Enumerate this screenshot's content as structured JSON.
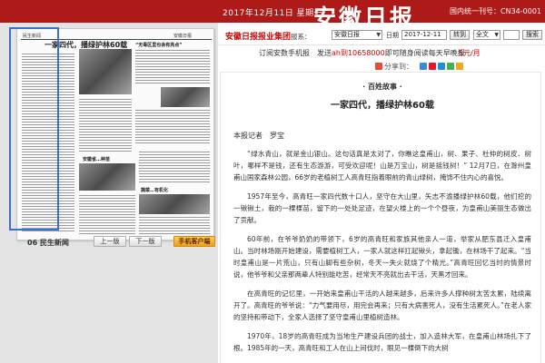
{
  "header": {
    "date_line": "2017年12月11日 星期一",
    "logo": "安徽日报",
    "cn_number": "国内统一刊号：CN34-0001"
  },
  "toolbar": {
    "brand_red": "安徽日报报业集团",
    "brand_dark": "报系：",
    "paper_select": "安徽日报",
    "date_label": "日期",
    "date_value": "2017-12-11",
    "go_button": "转到",
    "search_select": "全文",
    "search_button": "搜索"
  },
  "promo": {
    "text_a": "订阅安数手机报　发送",
    "text_red": "ah到10658000",
    "text_b": "即可随身阅读每天早晚报",
    "price": "5元/月"
  },
  "share": {
    "label": "分享到："
  },
  "thumbnail": {
    "page_header_left": "民生新闻",
    "page_header_right": "安徽日报",
    "article_title": "一家四代，播绿护林60载",
    "sub_1": "“无毒区里也会有亮点”",
    "sub_2": "安徽省…种苗",
    "sub_3": "蔬菜…有机化"
  },
  "pagenav": {
    "label": "06  民生新闻",
    "prev": "上一版",
    "next": "下一版",
    "mobile": "手机客户端"
  },
  "article": {
    "kicker": "· 百姓故事 ·",
    "title": "一家四代，播绿护林60载",
    "byline": "本报记者　罗宝",
    "paragraphs": [
      "“绿水青山，就是金山银山。这句话真是太对了，你瞧这皇甫山，树、果子、杜仲的树皮、树叶，哪样不是钱，还有生态游游，可受欢迎呢！山是万宝山，树是摇钱树！” 12月7日，在滁州皇甫山国家森林公园，66岁的老植树工人高青旺指着眼前的青山绿树，掩饰不住内心的喜悦。",
      "1957年至今，高青旺一家四代数十口人，坚守在大山里，矢志不渝播绿护林60载，他们挖的一锹锹土，栽的一棵棵苗，留下的一处处足迹，在望火楼上的一个个昼夜，为皇甫山美丽生态做出了贡献。",
      "60年前，在爷爷奶奶的带领下，6岁的高青旺和家族其他亲人一道，举家从肥东县迁入皇甫山。当时林场刚开始建设，需要植树工人，一家人就这样扛起锹头，拿起锄，在林场干了起来。“当时皇甫山是一片荒山，只有山脚有些杂树，冬天一失火就烧了个精光。”高青旺回忆当时的情景时说，他爷爷和父亲那两辈人特别能吃苦，经常天不亮就出去干活，天黑才回来。",
      "在高青旺的记忆里，一开始来皇甫山干活的人越来越多，后来许多人撑种树太苦太累，陆续离开了。高青旺的爷爷说：“力气要用尽，用完会再来；只有大病害死人，没有生活累死人。”在老人家的坚持和带动下，全家人选择了坚守皇甫山里植树造林。",
      "1970年，18岁的高青旺成为当地生产建设兵团的战士，加入造林大军，在皇甫山林场扎下了根。1985年的一天，高青旺和工人在山上间伐时，眼见一棵倒下的大树"
    ]
  },
  "colors": {
    "brand_red": "#ad1a18",
    "link_red": "#c30d0d",
    "selection_blue": "#3a6fd8",
    "mobile_orange": "#f0a020"
  }
}
